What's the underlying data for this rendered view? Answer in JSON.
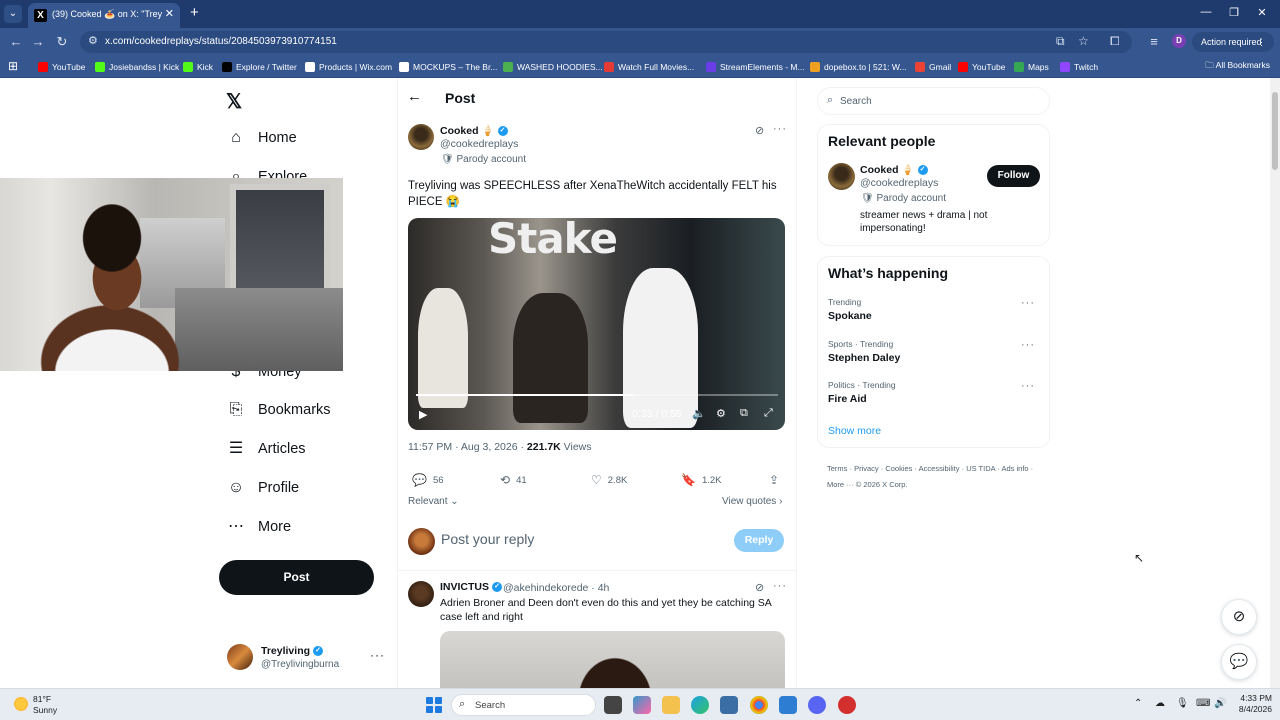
{
  "browser": {
    "tab_title": "(39) Cooked 🍝 on X: \"Treyliving",
    "url": "x.com/cookedreplays/status/2084503973910774151",
    "action_required": "Action required",
    "profile_initial": "D",
    "bookmarks": [
      {
        "label": "YouTube",
        "color": "#ff0000"
      },
      {
        "label": "Josiebandss | Kick",
        "color": "#53fc18"
      },
      {
        "label": "Kick",
        "color": "#53fc18"
      },
      {
        "label": "Explore / Twitter",
        "color": "#000000"
      },
      {
        "label": "Products | Wix.com",
        "color": "#ffffff"
      },
      {
        "label": "MOCKUPS – The Br...",
        "color": "#ffffff"
      },
      {
        "label": "WASHED HOODIES...",
        "color": "#4caf50"
      },
      {
        "label": "Watch Full Movies...",
        "color": "#e53935"
      },
      {
        "label": "StreamElements - M...",
        "color": "#6a3de8"
      },
      {
        "label": "dopebox.to | 521: W...",
        "color": "#f0a020"
      },
      {
        "label": "Gmail",
        "color": "#ea4335"
      },
      {
        "label": "YouTube",
        "color": "#ff0000"
      },
      {
        "label": "Maps",
        "color": "#34a853"
      },
      {
        "label": "Twitch",
        "color": "#9146ff"
      }
    ],
    "all_bookmarks": "All Bookmarks"
  },
  "nav": {
    "items": [
      {
        "label": "Home",
        "icon": "home-icon"
      },
      {
        "label": "Explore",
        "icon": "search-icon"
      },
      {
        "label": "Money",
        "icon": "money-icon"
      },
      {
        "label": "Bookmarks",
        "icon": "bookmark-icon"
      },
      {
        "label": "Articles",
        "icon": "articles-icon"
      },
      {
        "label": "Profile",
        "icon": "person-icon"
      },
      {
        "label": "More",
        "icon": "more-circle-icon"
      }
    ],
    "post_button": "Post",
    "account": {
      "name": "Treyliving",
      "handle": "@Treylivingburna"
    }
  },
  "post": {
    "header_title": "Post",
    "author_name": "Cooked 🍦",
    "author_handle": "@cookedreplays",
    "parody_label": "Parody account",
    "text": "Treyliving was SPEECHLESS after XenaTheWitch accidentally FELT his PIECE 😭",
    "video": {
      "sign_text": "Stake",
      "time": "0:33 / 0:55",
      "progress": 0.6
    },
    "timestamp": "11:57 PM · Aug 3, 2026 · ",
    "views_count": "221.7K",
    "views_label": " Views",
    "stats": {
      "replies": "56",
      "reposts": "41",
      "likes": "2.8K",
      "bookmarks": "1.2K"
    },
    "sort_label": "Relevant",
    "view_quotes": "View quotes",
    "reply_placeholder": "Post your reply",
    "reply_button": "Reply"
  },
  "reply": {
    "name": "INVICTUS",
    "handle_time": "@akehindekorede · 4h",
    "text": "Adrien Broner and Deen don't even do this and yet they be catching SA case left and right"
  },
  "sidebar": {
    "search_placeholder": "Search",
    "relevant_title": "Relevant people",
    "person": {
      "name": "Cooked 🍦",
      "handle": "@cookedreplays",
      "follow": "Follow",
      "parody": "Parody account",
      "bio": "streamer news + drama | not impersonating!"
    },
    "happening_title": "What’s happening",
    "trends": [
      {
        "category": "Trending",
        "name": "Spokane"
      },
      {
        "category": "Sports · Trending",
        "name": "Stephen Daley"
      },
      {
        "category": "Politics · Trending",
        "name": "Fire Aid"
      }
    ],
    "show_more": "Show more",
    "footer": "Terms · Privacy · Cookies · Accessibility · US TIDA · Ads info · More ··· © 2026 X Corp."
  },
  "taskbar": {
    "temp": "81°F",
    "condition": "Sunny",
    "search": "Search",
    "time": "4:33 PM",
    "date": "8/4/2026"
  }
}
